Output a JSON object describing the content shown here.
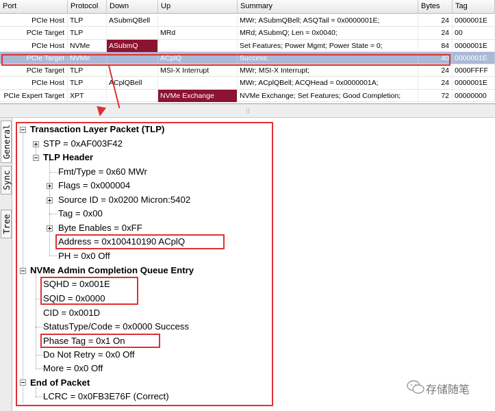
{
  "grid": {
    "columns": [
      "Port",
      "Protocol",
      "Down",
      "Up",
      "Summary",
      "Bytes",
      "Tag"
    ],
    "rows": [
      {
        "port": "PCIe Host",
        "protocol": "TLP",
        "down": "ASubmQBell",
        "up": "",
        "summary": "MWr; ASubmQBell; ASQTail = 0x0000001E;",
        "bytes": "24",
        "tag": "0000001E"
      },
      {
        "port": "PCIe Target",
        "protocol": "TLP",
        "down": "",
        "up": "MRd",
        "summary": "MRd; ASubmQ; Len = 0x0040;",
        "bytes": "24",
        "tag": "00"
      },
      {
        "port": "PCIe Host",
        "protocol": "NVMe",
        "down": "ASubmQ",
        "up": "",
        "summary": "Set Features; Power Mgmt; Power State = 0;",
        "bytes": "84",
        "tag": "0000001E"
      },
      {
        "port": "PCIe Target",
        "protocol": "NVMe",
        "down": "",
        "up": "ACplQ",
        "summary": "Success;",
        "bytes": "40",
        "tag": "0000001E"
      },
      {
        "port": "PCIe Target",
        "protocol": "TLP",
        "down": "",
        "up": "MSI-X Interrupt",
        "summary": "MWr; MSI-X Interrupt;",
        "bytes": "24",
        "tag": "0000FFFF"
      },
      {
        "port": "PCIe Host",
        "protocol": "TLP",
        "down": "ACplQBell",
        "up": "",
        "summary": "MWr; ACplQBell; ACQHead = 0x0000001A;",
        "bytes": "24",
        "tag": "0000001E"
      },
      {
        "port": "PCIe Expert Target",
        "protocol": "XPT",
        "down": "",
        "up": "NVMe Exchange",
        "summary": "NVMe Exchange; Set Features; Good Completion;",
        "bytes": "72",
        "tag": "00000000"
      }
    ],
    "selected_row": 3
  },
  "side_tabs": [
    "General",
    "Sync",
    "Tree"
  ],
  "tree": {
    "tlp": "Transaction Layer Packet (TLP)",
    "stp": "STP   =   0xAF003F42",
    "tlp_header": "TLP Header",
    "fmt_type": "Fmt/Type   =   0x60  MWr",
    "flags": "Flags   =   0x000004",
    "source_id": "Source ID   =   0x0200  Micron:5402",
    "tag": "Tag   =   0x00",
    "byte_enables": "Byte Enables   =   0xFF",
    "address": "Address   =   0x100410190  ACplQ",
    "ph": "PH   =   0x0  Off",
    "nvme_entry": "NVMe Admin Completion Queue Entry",
    "sqhd": "SQHD   =   0x001E",
    "sqid": "SQID   =   0x0000",
    "cid": "CID   =   0x001D",
    "status": "StatusType/Code   =   0x0000  Success",
    "phase_tag": "Phase Tag   =   0x1  On",
    "do_not_retry": "Do Not Retry   =   0x0  Off",
    "more": "More   =   0x0  Off",
    "end_of_packet": "End of Packet",
    "lcrc": "LCRC   =   0x0FB3E76F    (Correct)"
  },
  "watermark": {
    "text": "存储随笔"
  },
  "colors": {
    "highlight_red": "#e03030",
    "selected_row": "#aab9d6",
    "direction_cell": "#8b1430"
  }
}
